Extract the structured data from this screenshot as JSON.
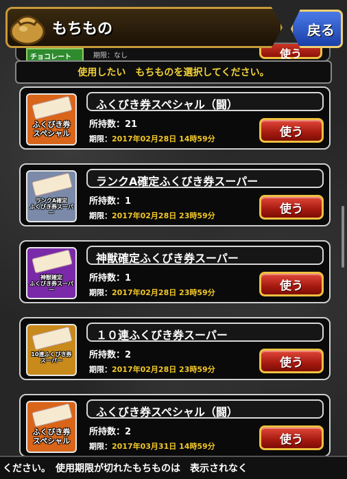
{
  "header": {
    "title": "もちもの",
    "back_label": "戻る"
  },
  "peek_item": {
    "icon_text": "チョコレート",
    "text": "期限：なし",
    "button_label": "使う"
  },
  "instruction": "使用したい　もちものを選択してください。",
  "qty_label": "所持数：",
  "expiry_label": "期限：",
  "items": [
    {
      "name": "ふくびき券スペシャル（闘）",
      "qty": "21",
      "expiry": "2017年02月28日 14時59分",
      "icon_label": "ふくびき券\nスペシャル",
      "button": "使う",
      "color": "#d9651a"
    },
    {
      "name": "ランクA確定ふくびき券スーパー",
      "qty": "1",
      "expiry": "2017年02月28日 23時59分",
      "icon_label": "ランクA確定\nふくびき券スーパー",
      "button": "使う",
      "color": "#7a8aa8"
    },
    {
      "name": "神獣確定ふくびき券スーパー",
      "qty": "1",
      "expiry": "2017年02月28日 23時59分",
      "icon_label": "神獣確定\nふくびき券スーパー",
      "button": "使う",
      "color": "#7a2aa8"
    },
    {
      "name": "１０連ふくびき券スーパー",
      "qty": "2",
      "expiry": "2017年02月28日 23時59分",
      "icon_label": "10連ふくびき券\nスーパー",
      "button": "使う",
      "color": "#c88a1a"
    },
    {
      "name": "ふくびき券スペシャル（闘）",
      "qty": "2",
      "expiry": "2017年03月31日 14時59分",
      "icon_label": "ふくびき券\nスペシャル",
      "button": "使う",
      "color": "#d9651a"
    }
  ],
  "footer": "ください。　使用期限が切れたもちものは　表示されなく"
}
